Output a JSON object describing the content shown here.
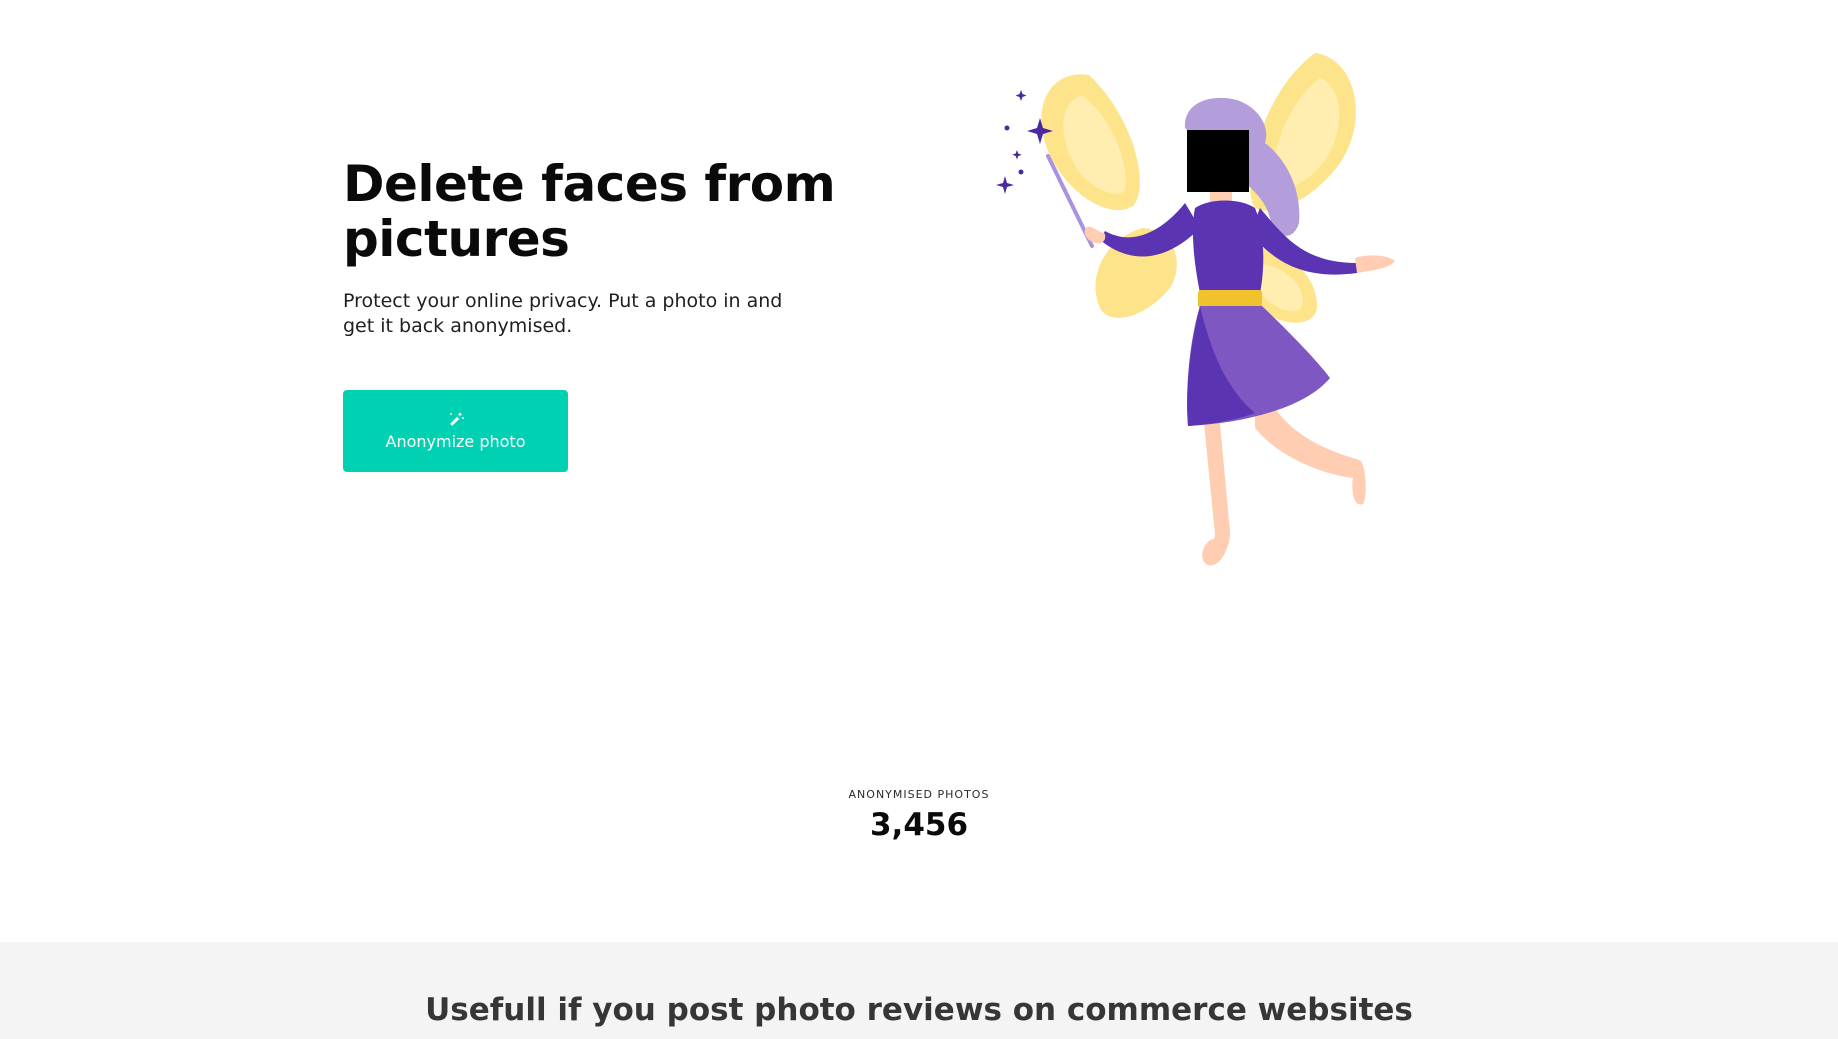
{
  "hero": {
    "title": "Delete faces from pictures",
    "subtitle": "Protect your online privacy. Put a photo in and get it back anonymised.",
    "cta_label": "Anonymize photo",
    "cta_icon": "magic-wand-icon",
    "illustration": "fairy-illustration"
  },
  "stats": {
    "heading": "ANONYMISED PHOTOS",
    "value": "3,456"
  },
  "section": {
    "title": "Usefull if you post photo reviews on commerce websites"
  },
  "colors": {
    "accent": "#00d1b2",
    "fairy_dress": "#5b34b3",
    "fairy_wings": "#fde68a",
    "section_background": "#f4f4f4"
  }
}
